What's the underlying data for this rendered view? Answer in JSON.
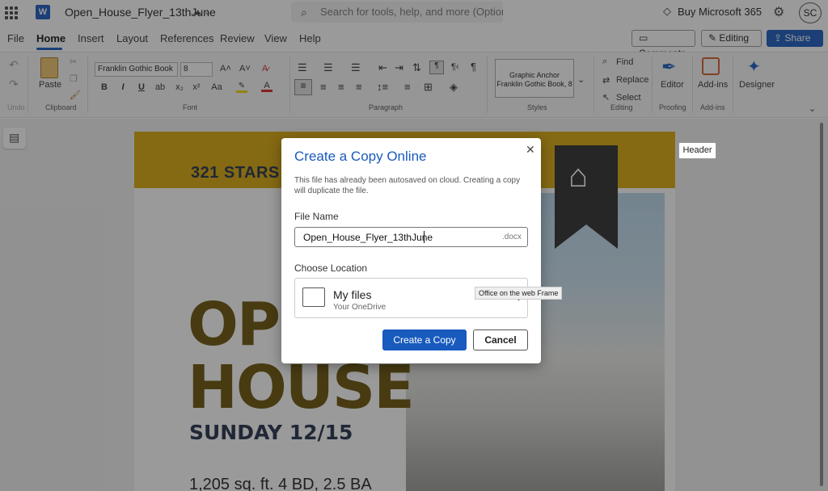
{
  "app": {
    "doc_title": "Open_House_Flyer_13thJune",
    "search_placeholder": "Search for tools, help, and more (Option + Q)",
    "buy_label": "Buy Microsoft 365",
    "user_initials": "SC",
    "logo_letter": "W"
  },
  "tabs": [
    "File",
    "Home",
    "Insert",
    "Layout",
    "References",
    "Review",
    "View",
    "Help"
  ],
  "right_buttons": {
    "comments": "Comments",
    "editing": "Editing",
    "share": "Share"
  },
  "ribbon": {
    "groups": {
      "undo": "Undo",
      "clipboard": "Clipboard",
      "font": "Font",
      "paragraph": "Paragraph",
      "styles": "Styles",
      "editing": "Editing",
      "proofing": "Proofing",
      "addins": "Add-ins"
    },
    "paste": "Paste",
    "font_name": "Franklin Gothic Book",
    "font_size": "8",
    "style_name": "Graphic Anchor",
    "style_desc": "Franklin Gothic Book, 8",
    "find": "Find",
    "replace": "Replace",
    "select": "Select",
    "editor": "Editor",
    "addins_btn": "Add-ins",
    "designer": "Designer",
    "format_buttons": [
      "B",
      "I",
      "U",
      "x₂",
      "x²"
    ]
  },
  "document": {
    "header_tag": "Header",
    "stars": "321 STARS",
    "open": "OPE",
    "house": "HOUSE",
    "sunday": "SUNDAY 12/15",
    "details": "1,205 sq. ft. 4 BD, 2.5 BA"
  },
  "dialog": {
    "title": "Create a Copy Online",
    "description": "This file has already been autosaved on cloud. Creating a copy will duplicate the file.",
    "file_name_label": "File Name",
    "file_name_value": "Open_House_Flyer_13thJune",
    "extension": ".docx",
    "location_label": "Choose Location",
    "location_name": "My files",
    "location_sub": "Your OneDrive",
    "tooltip": "Office on the web Frame",
    "create_button": "Create a Copy",
    "cancel_button": "Cancel"
  }
}
